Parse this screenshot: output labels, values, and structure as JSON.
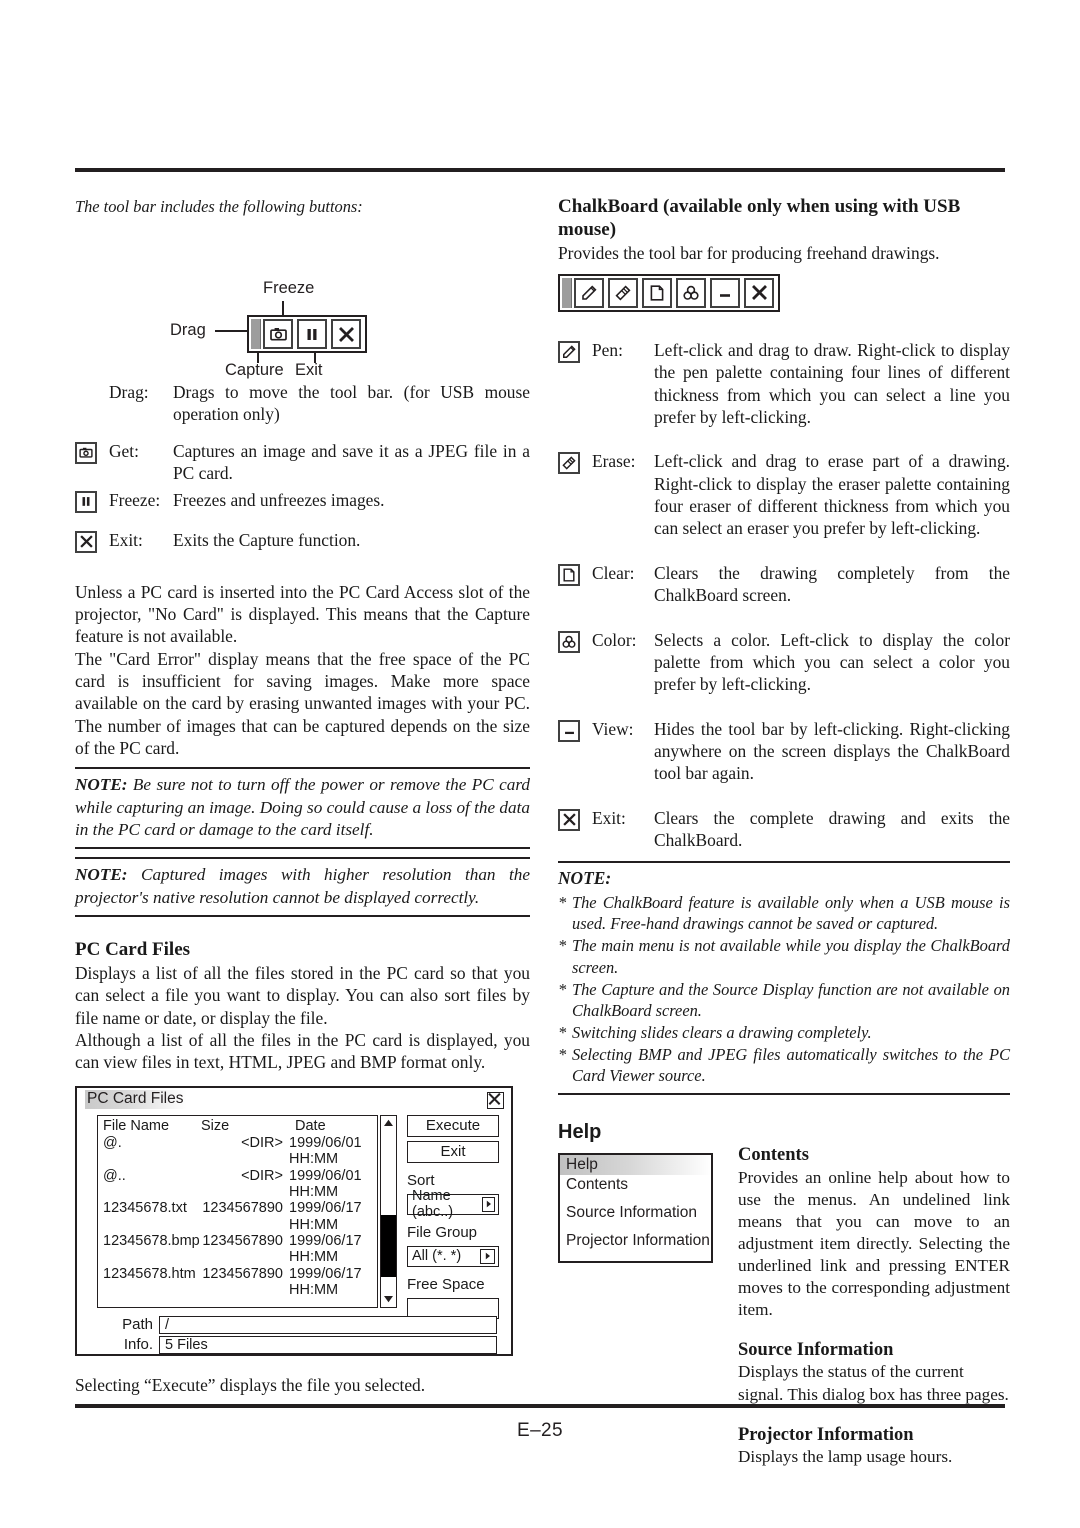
{
  "page": {
    "footer": "E–25"
  },
  "left": {
    "intro": "The tool bar includes the following buttons:",
    "capture_toolbar": {
      "labels": {
        "drag": "Drag",
        "freeze": "Freeze",
        "capture": "Capture",
        "exit": "Exit"
      },
      "buttons": [
        {
          "name": "get-camera-icon",
          "title": "Get"
        },
        {
          "name": "freeze-pause-icon",
          "title": "Freeze"
        },
        {
          "name": "exit-close-icon",
          "title": "Exit"
        }
      ]
    },
    "definitions": [
      {
        "icon": "",
        "term": "Drag:",
        "desc": "Drags to move the tool bar. (for USB mouse operation only)"
      },
      {
        "icon": "get-camera-icon",
        "term": "Get:",
        "desc": "Captures an image and save it as a JPEG file in a PC card."
      },
      {
        "icon": "freeze-pause-icon",
        "term": "Freeze:",
        "desc": "Freezes and unfreezes images."
      },
      {
        "icon": "exit-close-icon",
        "term": "Exit:",
        "desc": "Exits the Capture function."
      }
    ],
    "body1": "Unless a PC card is inserted into the PC Card Access slot of the projector, \"No Card\" is displayed. This means that the Capture feature is not available.",
    "body2": "The \"Card Error\" display means that the free space of the PC card is insufficient for saving images. Make more space available on the card by erasing unwanted images with your PC. The number of images that can be captured depends on the size of the PC card.",
    "note1_label": "NOTE:",
    "note1_text": " Be sure not to turn off the power or remove the PC card while capturing an image. Doing so could cause a loss of the data in the PC card or damage to the card itself.",
    "note2_label": "NOTE:",
    "note2_text": " Captured images with higher resolution than the projector's native resolution cannot be displayed correctly.",
    "pc_card_files": {
      "heading": "PC Card Files",
      "para1": "Displays a list of all the files stored in the PC card so that you can select a file you want to display. You can also sort files by file name or date, or display the file.",
      "para2": "Although a list of all the files in the PC card is displayed, you can view files in text, HTML, JPEG and BMP format only.",
      "caption": "Selecting “Execute” displays the file you selected."
    }
  },
  "dialog": {
    "title": "PC Card Files",
    "columns": [
      "File Name",
      "Size",
      "Date"
    ],
    "rows": [
      {
        "name": "@.",
        "size": "<DIR>",
        "date": "1999/06/01 HH:MM"
      },
      {
        "name": "@..",
        "size": "<DIR>",
        "date": "1999/06/01 HH:MM"
      },
      {
        "name": "12345678.txt",
        "size": "1234567890",
        "date": "1999/06/17 HH:MM"
      },
      {
        "name": "12345678.bmp",
        "size": "1234567890",
        "date": "1999/06/17 HH:MM"
      },
      {
        "name": "12345678.htm",
        "size": "1234567890",
        "date": "1999/06/17 HH:MM"
      }
    ],
    "execute_label": "Execute",
    "exit_label": "Exit",
    "sort_label": "Sort",
    "sort_value": "Name (abc..)",
    "file_group_label": "File Group",
    "file_group_value": "All (*. *)",
    "free_space_label": "Free Space",
    "free_space_value": "",
    "path_label": "Path",
    "path_value": "/",
    "info_label": "Info.",
    "info_value": "5 Files"
  },
  "right": {
    "chalkboard": {
      "heading": "ChalkBoard (available only when using with USB mouse)",
      "intro": "Provides the tool bar for producing freehand drawings.",
      "toolbar_buttons": [
        {
          "name": "pen-icon",
          "title": "Pen"
        },
        {
          "name": "eraser-icon",
          "title": "Erase"
        },
        {
          "name": "page-clear-icon",
          "title": "Clear"
        },
        {
          "name": "color-palette-icon",
          "title": "Color"
        },
        {
          "name": "minimize-view-icon",
          "title": "View"
        },
        {
          "name": "exit-close-icon",
          "title": "Exit"
        }
      ],
      "definitions": [
        {
          "icon": "pen-icon",
          "term": "Pen:",
          "desc": "Left-click and drag to draw. Right-click to display the pen palette containing four lines of different thickness from which you can select a line you prefer by left-clicking."
        },
        {
          "icon": "eraser-icon",
          "term": "Erase:",
          "desc": "Left-click and drag to erase part of a drawing. Right-click to display the eraser palette containing four eraser of different thickness from which you can select an eraser you prefer by left-clicking."
        },
        {
          "icon": "page-clear-icon",
          "term": "Clear:",
          "desc": "Clears the drawing completely from the ChalkBoard screen."
        },
        {
          "icon": "color-palette-icon",
          "term": "Color:",
          "desc": "Selects a color. Left-click to display the color palette from which you can select a color you prefer by left-clicking."
        },
        {
          "icon": "minimize-view-icon",
          "term": "View:",
          "desc": "Hides the tool bar by left-clicking. Right-clicking anywhere on the screen displays the ChalkBoard tool bar again."
        },
        {
          "icon": "exit-close-icon",
          "term": "Exit:",
          "desc": "Clears the complete drawing and exits the ChalkBoard."
        }
      ]
    },
    "note": {
      "label": "NOTE:",
      "items": [
        "The ChalkBoard feature is available only when a USB mouse is used. Free-hand drawings cannot be saved or captured.",
        "The main menu is not available while you display the ChalkBoard screen.",
        "The Capture and the Source Display function are not available on ChalkBoard screen.",
        "Switching slides clears a drawing completely.",
        "Selecting BMP and JPEG files automatically switches to the PC Card Viewer source."
      ]
    },
    "help": {
      "heading": "Help",
      "menu_items": [
        "Help",
        "Contents",
        "Source Information",
        "Projector Information"
      ],
      "sections": [
        {
          "title": "Contents",
          "text": "Provides an online help about how to use the menus. An undelined link means that you can move to an adjustment item directly. Selecting the underlined link and pressing ENTER moves to the corresponding adjustment item."
        },
        {
          "title": "Source Information",
          "text": "Displays the status of the current signal. This dialog box has three pages."
        },
        {
          "title": "Projector Information",
          "text": "Displays the lamp usage hours."
        }
      ]
    }
  }
}
